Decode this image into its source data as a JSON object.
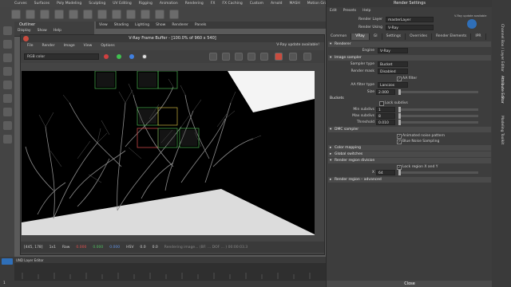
{
  "shelf": {
    "tabs": [
      "Curves",
      "Surfaces",
      "Poly Modeling",
      "Sculpting",
      "UV Editing",
      "Rigging",
      "Animation",
      "Rendering",
      "FX",
      "FX Caching",
      "Custom",
      "Arnold",
      "MASH",
      "Motion Graphics"
    ]
  },
  "outliner": {
    "title": "Outliner",
    "menu": [
      "Display",
      "Show",
      "Help"
    ]
  },
  "viewport_menu": [
    "View",
    "Shading",
    "Lighting",
    "Show",
    "Renderer",
    "Panels"
  ],
  "vfb": {
    "title": "V-Ray Frame Buffer - [100.0% of 960 x 540]",
    "menu": [
      "File",
      "Render",
      "Image",
      "View",
      "Options"
    ],
    "update_notice": "V-Ray update available!",
    "channel": "RGB color",
    "status": {
      "coords": "[445, 178]",
      "scale": "1x1",
      "mode": "Raw",
      "r": "0.000",
      "g": "0.000",
      "b": "0.000",
      "space": "HSV",
      "v1": "0.0",
      "v2": "0.0",
      "progress_text": "Rendering image... (BF: ... DOF ... ) 00:00:03.3"
    }
  },
  "render_settings": {
    "title": "Render Settings",
    "menu": [
      "Edit",
      "Presets",
      "Help"
    ],
    "render_layer_label": "Render Layer",
    "render_layer_value": "masterLayer",
    "render_using_label": "Render Using",
    "render_using_value": "V-Ray",
    "badge_text": "V-Ray update available",
    "tabs": [
      "Common",
      "VRay",
      "GI",
      "Settings",
      "Overrides",
      "Render Elements",
      "IPR"
    ],
    "active_tab": "VRay",
    "sections": {
      "renderer": "Renderer",
      "image_sampler": "Image sampler",
      "buckets": "Buckets",
      "dmc": "DMC sampler",
      "color_mapping": "Color mapping",
      "global_switches": "Global switches",
      "region_division": "Render region division",
      "region_advanced": "Render region – advanced"
    },
    "engine_label": "Engine",
    "engine_value": "V-Ray",
    "sampler_type_label": "Sampler type",
    "sampler_type_value": "Bucket",
    "render_mask_label": "Render mask",
    "render_mask_value": "Disabled",
    "aa_filter_label": "AA filter",
    "aa_filter_type_label": "AA filter type",
    "aa_filter_type_value": "Lanczos",
    "size_label": "Size",
    "size_value": "2.000",
    "lock_subdivs_label": "Lock subdivs",
    "min_subdivs_label": "Min subdivs",
    "min_subdivs_value": "1",
    "max_subdivs_label": "Max subdivs",
    "max_subdivs_value": "8",
    "threshold_label": "Threshold",
    "threshold_value": "0.010",
    "animated_noise_label": "Animated noise pattern",
    "blue_noise_label": "Blue Noise Sampling",
    "lock_region_label": "Lock region X and Y",
    "region_x_label": "X",
    "region_x_value": "64",
    "close_label": "Close"
  },
  "attr_strip": [
    "Channel Box / Layer Editor",
    "Attribute Editor",
    "Modeling Toolkit"
  ],
  "layer_editor": {
    "label": "UND Layer Editor"
  },
  "timeline": {
    "end_label": "1"
  },
  "colors": {
    "panel": "#3d3d3d",
    "dark": "#2b2b2b",
    "render_bg": "#000000",
    "close_red": "#c94c3f",
    "accent_green": "#4cb050"
  }
}
